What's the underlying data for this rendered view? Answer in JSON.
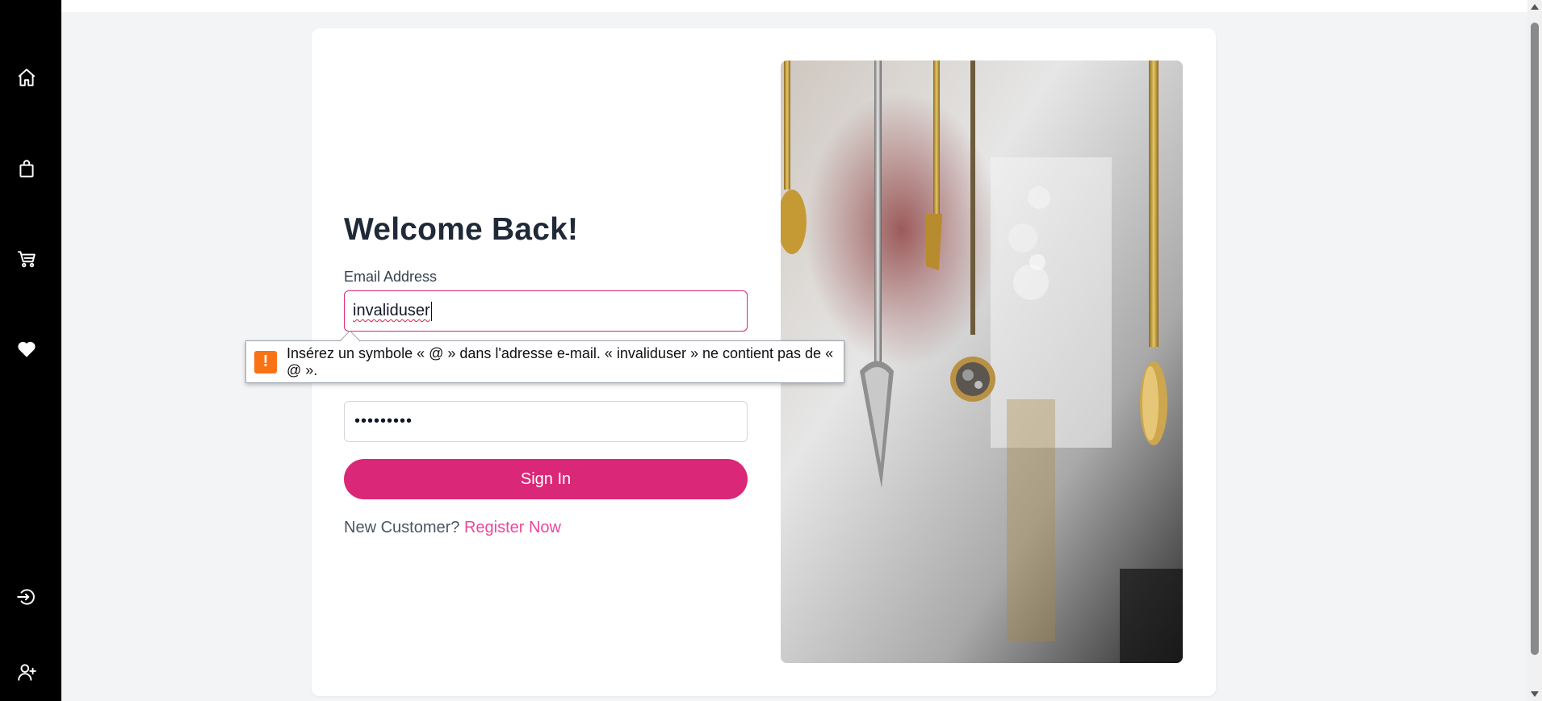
{
  "sidebar": {
    "icons": [
      "home-icon",
      "shopping-bag-icon",
      "cart-icon",
      "heart-icon",
      "login-icon",
      "user-plus-icon"
    ]
  },
  "login": {
    "title": "Welcome Back!",
    "email_label": "Email Address",
    "email_value": "invaliduser",
    "password_value": "•••••••••",
    "signin_label": "Sign In",
    "new_customer_text": "New Customer?",
    "register_link": "Register Now"
  },
  "validation": {
    "icon": "!",
    "message": "Insérez un symbole « @ » dans l'adresse e-mail. « invaliduser » ne contient pas de « @ »."
  },
  "colors": {
    "accent": "#db2777",
    "link": "#ec4899",
    "warning": "#f97316",
    "sidebar_bg": "#000000"
  }
}
